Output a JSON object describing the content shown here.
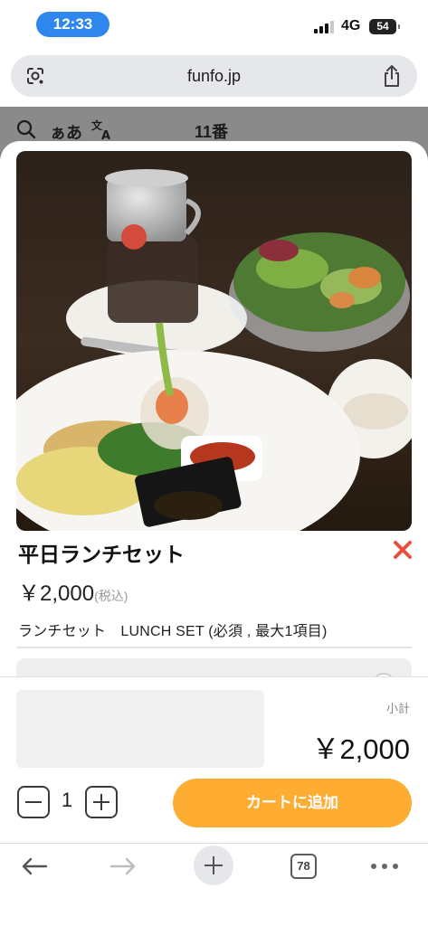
{
  "status_bar": {
    "time": "12:33",
    "network": "4G",
    "battery": "54"
  },
  "browser": {
    "url": "funfo.jp",
    "tab_count": "78"
  },
  "page_header": {
    "font_toggle": "ぁあ",
    "title": "11番"
  },
  "item": {
    "name": "平日ランチセット",
    "price": "￥2,000",
    "price_note": "(税込)",
    "option_label": "ランチセット　LUNCH SET (必須 , 最大1項目)"
  },
  "footer": {
    "subtotal_label": "小計",
    "subtotal_value": "￥2,000",
    "quantity": "1",
    "add_to_cart": "カートに追加"
  },
  "colors": {
    "accent": "#ffac33",
    "close": "#e8513c",
    "time_pill": "#2f86ec"
  },
  "icons": [
    "lens-icon",
    "share-icon",
    "search-icon",
    "translate-icon",
    "close-icon",
    "back-arrow-icon",
    "forward-arrow-icon",
    "plus-icon",
    "more-icon"
  ]
}
